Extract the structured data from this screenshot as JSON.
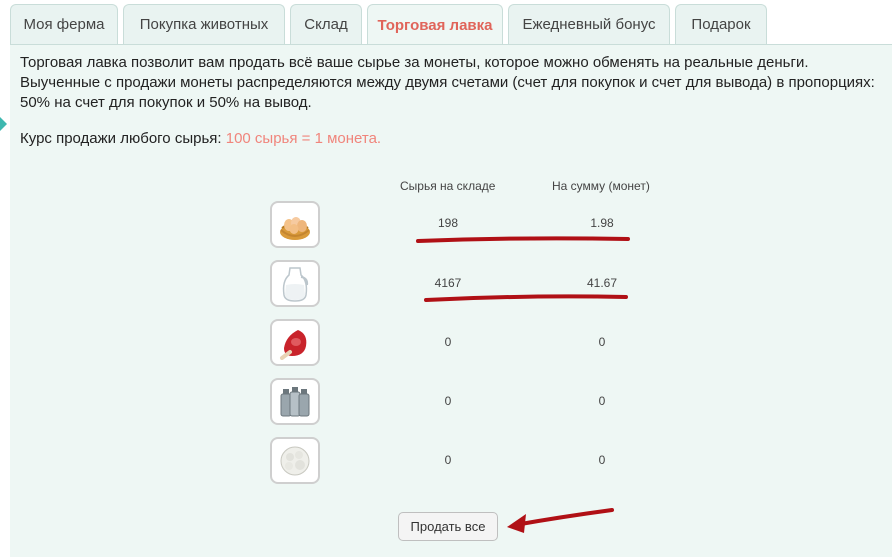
{
  "tabs": [
    {
      "label": "Моя ферма",
      "active": false
    },
    {
      "label": "Покупка животных",
      "active": false
    },
    {
      "label": "Склад",
      "active": false
    },
    {
      "label": "Торговая лавка",
      "active": true
    },
    {
      "label": "Ежедневный бонус",
      "active": false
    },
    {
      "label": "Подарок",
      "active": false
    }
  ],
  "description": {
    "line1": "Торговая лавка позволит вам продать всё ваше сырье за монеты, которое можно обменять на реальные деньги.",
    "line2": "Выученные с продажи монеты распределяются между двумя счетами (счет для покупок и счет для вывода) в пропорциях:",
    "line3": "50% на счет для покупок и 50% на вывод."
  },
  "rate": {
    "label": "Курс продажи любого сырья:",
    "value": "100 сырья = 1 монета."
  },
  "table": {
    "headers": [
      "Сырья на складе",
      "На сумму (монет)"
    ],
    "rows": [
      {
        "icon": "eggs-basket-icon",
        "stock": "198",
        "sum": "1.98"
      },
      {
        "icon": "milk-jug-icon",
        "stock": "4167",
        "sum": "41.67"
      },
      {
        "icon": "meat-ham-icon",
        "stock": "0",
        "sum": "0"
      },
      {
        "icon": "milk-cans-icon",
        "stock": "0",
        "sum": "0"
      },
      {
        "icon": "wool-ball-icon",
        "stock": "0",
        "sum": "0"
      }
    ]
  },
  "sell_button": "Продать все",
  "colors": {
    "accent": "#e0645a",
    "highlight": "#f0857c",
    "annotation": "#b01015",
    "panel": "#eef7f4"
  }
}
